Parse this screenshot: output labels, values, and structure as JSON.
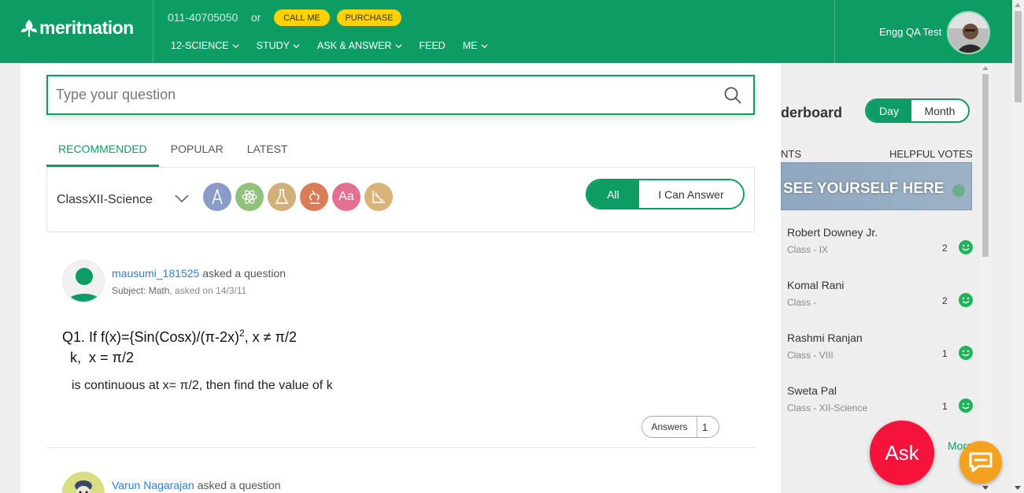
{
  "header": {
    "logo_text": "meritnation",
    "phone": "011-40705050",
    "or_text": "or",
    "call_label": "CALL ME",
    "purchase_label": "PURCHASE",
    "nav": [
      {
        "label": "12-SCIENCE"
      },
      {
        "label": "STUDY"
      },
      {
        "label": "ASK & ANSWER"
      },
      {
        "label": "FEED"
      },
      {
        "label": "ME"
      }
    ],
    "user_name": "Engg QA Test"
  },
  "search": {
    "placeholder": "Type your question"
  },
  "tabs": [
    {
      "label": "RECOMMENDED",
      "active": true
    },
    {
      "label": "POPULAR",
      "active": false
    },
    {
      "label": "LATEST",
      "active": false
    }
  ],
  "filter": {
    "class_value": "ClassXII-Science",
    "subjects": [
      {
        "icon": "compass-icon",
        "color": "#8b9bc9"
      },
      {
        "icon": "atom-icon",
        "color": "#8fc27a"
      },
      {
        "icon": "flask-icon",
        "color": "#d1b07b"
      },
      {
        "icon": "microscope-icon",
        "color": "#da7c58"
      },
      {
        "icon": "english-icon",
        "glyph": "Aa",
        "color": "#e36f93"
      },
      {
        "icon": "graph-icon",
        "color": "#d8b37a"
      }
    ],
    "toggle_all": "All",
    "toggle_answer": "I Can Answer"
  },
  "question1": {
    "user": "mausumi_181525",
    "action": "asked a question",
    "subject": "Subject: Math",
    "date": ", asked on 14/3/11",
    "line1_pre": "Q1.  If f(x)={Sin(Cosx)/(π-2x)",
    "line1_sup": "2",
    "line1_post": ",  x ≠ π/2",
    "line2": "  k,  x = π/2",
    "line3": "is continuous at x= π/2, then find the value of k",
    "answers_label": "Answers",
    "answers_count": "1"
  },
  "question2": {
    "user": "Varun Nagarajan",
    "action": "asked a question"
  },
  "leaderboard": {
    "title": "derboard",
    "toggle_day": "Day",
    "toggle_month": "Month",
    "head_left": "NTS",
    "head_right": "HELPFUL VOTES",
    "banner": "SEE YOURSELF HERE",
    "rows": [
      {
        "name": "Robert Downey Jr.",
        "class": "Class - IX",
        "votes": "2"
      },
      {
        "name": "Komal Rani",
        "class": "Class -",
        "votes": "2"
      },
      {
        "name": "Rashmi Ranjan",
        "class": "Class - VIII",
        "votes": "1"
      },
      {
        "name": "Sweta Pal",
        "class": "Class - XII-Science",
        "votes": "1"
      }
    ],
    "more": "More"
  },
  "ask_label": "Ask"
}
